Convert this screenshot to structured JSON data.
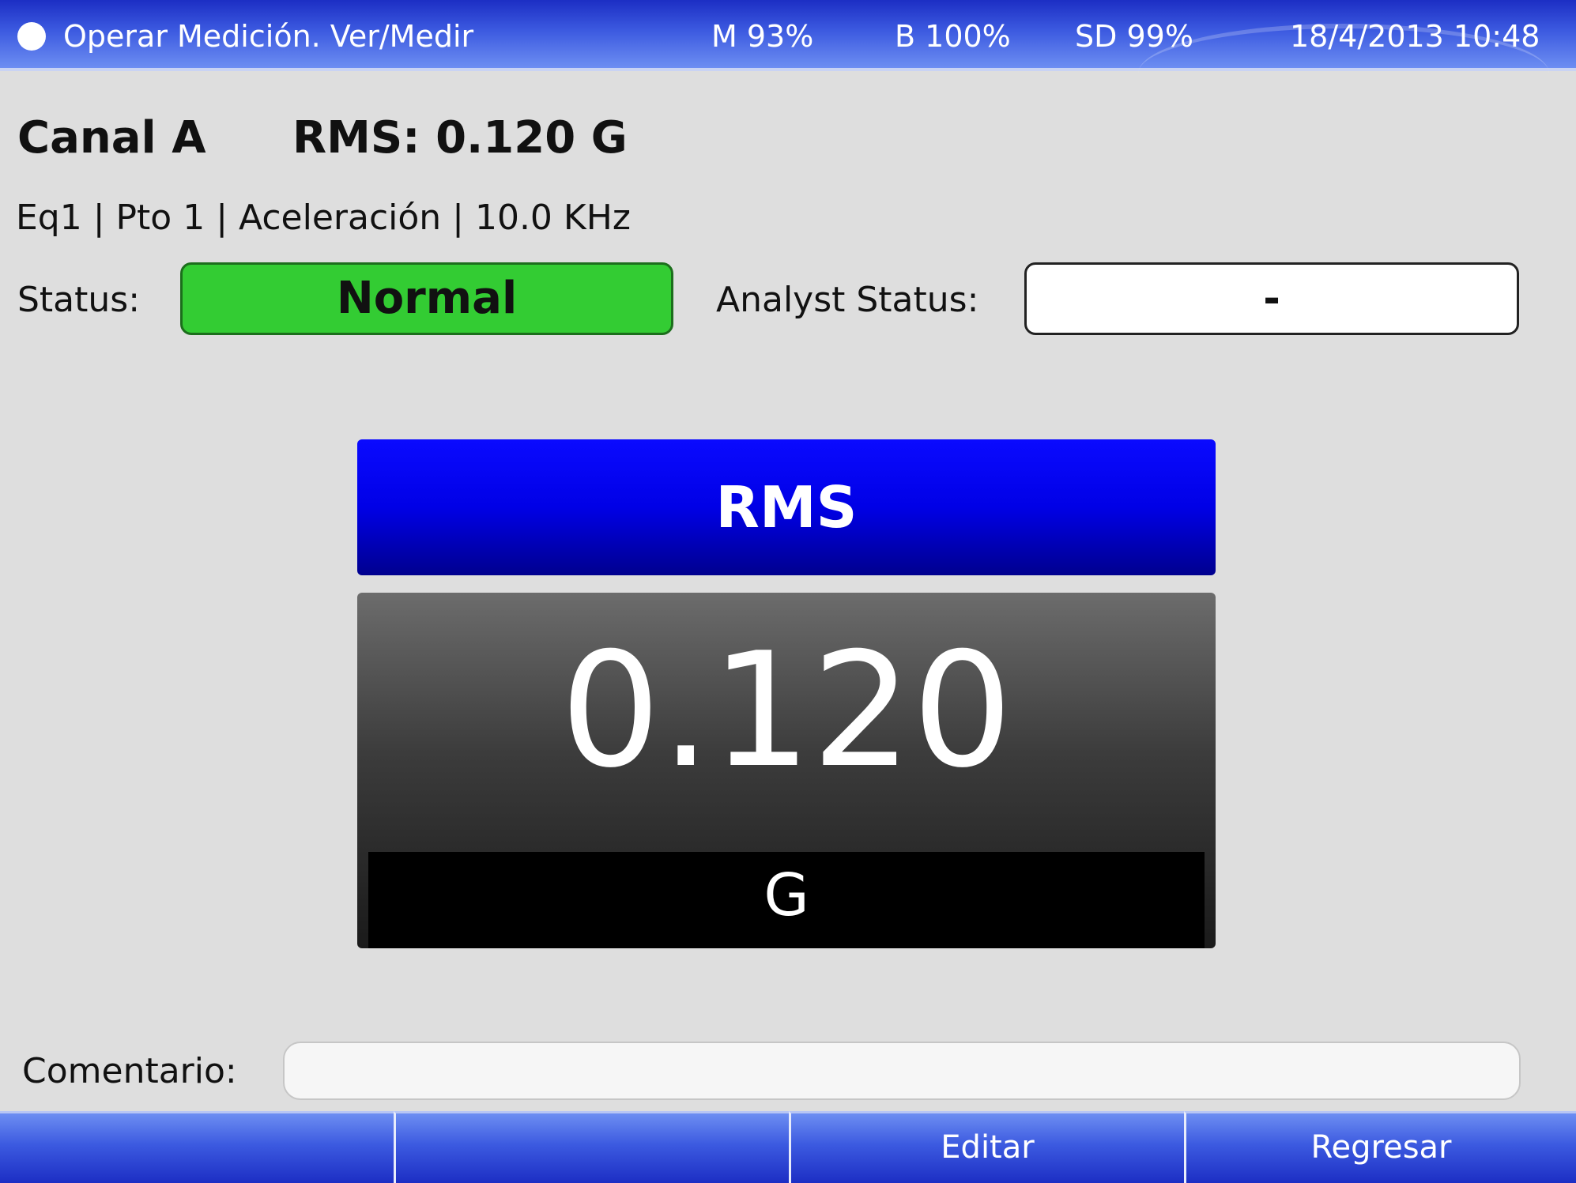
{
  "status_bar": {
    "title": "Operar Medición. Ver/Medir",
    "memory": "M 93%",
    "battery": "B 100%",
    "sd_card": "SD 99%",
    "datetime": "18/4/2013 10:48"
  },
  "header": {
    "channel": "Canal A",
    "rms_summary": "RMS: 0.120 G",
    "path": "Eq1 | Pto 1 | Aceleración | 10.0 KHz"
  },
  "status": {
    "label": "Status:",
    "value": "Normal",
    "value_color": "#33cc33",
    "analyst_label": "Analyst Status:",
    "analyst_value": "-"
  },
  "meter": {
    "title": "RMS",
    "value": "0.120",
    "unit": "G"
  },
  "comment": {
    "label": "Comentario:",
    "value": ""
  },
  "softkeys": [
    {
      "label": ""
    },
    {
      "label": ""
    },
    {
      "label": "Editar"
    },
    {
      "label": "Regresar"
    }
  ],
  "colors": {
    "bar_blue": "#3c5ae0",
    "meter_title_blue": "#0000e6",
    "background": "#dedede"
  }
}
